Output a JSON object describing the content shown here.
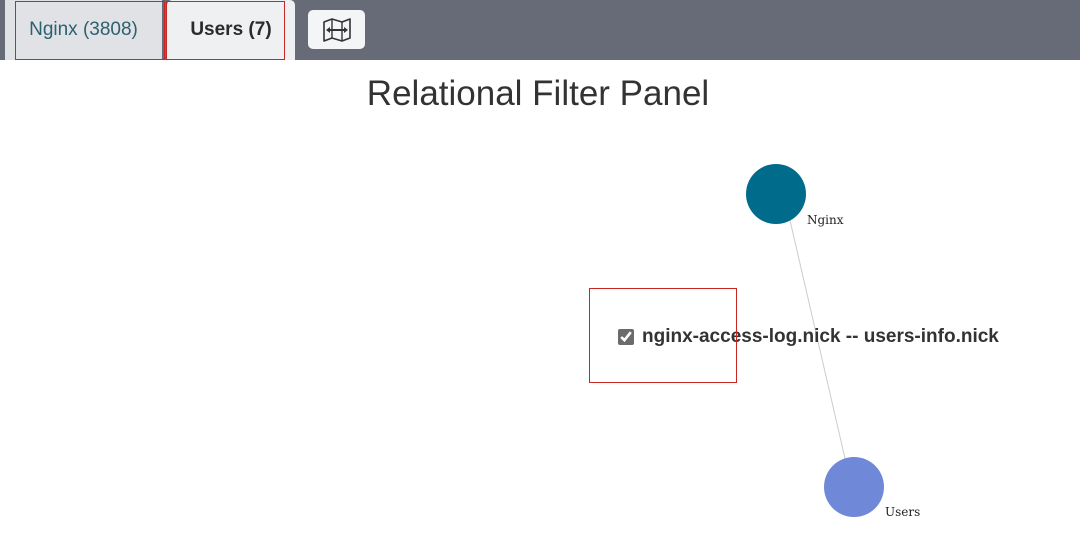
{
  "tabs": [
    {
      "label": "Nginx (3808)"
    },
    {
      "label": "Users (7)"
    }
  ],
  "map_button": {
    "icon": "map-icon"
  },
  "panel": {
    "title": "Relational Filter Panel"
  },
  "graph": {
    "nodes": [
      {
        "label": "Nginx",
        "color": "#006b8a"
      },
      {
        "label": "Users",
        "color": "#7088d8"
      }
    ],
    "link": {
      "label": "nginx-access-log.nick -- users-info.nick",
      "checked": true,
      "line_color": "#cccccc"
    }
  }
}
